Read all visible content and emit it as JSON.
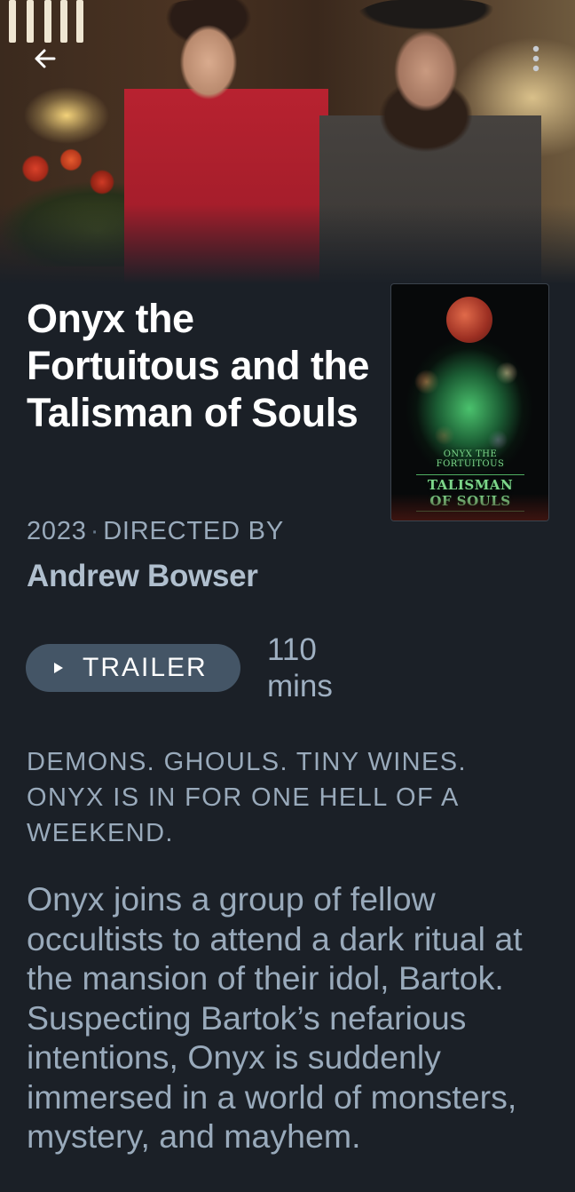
{
  "header": {
    "back_icon": "arrow-left-icon",
    "more_icon": "more-vertical-icon"
  },
  "film": {
    "title": "Onyx the Fortuitous and the Talisman of Souls",
    "year": "2023",
    "separator": "·",
    "directed_by_label": "DIRECTED BY",
    "director": "Andrew Bowser",
    "runtime": "110 mins",
    "tagline": "DEMONS. GHOULS. TINY WINES. ONYX IS IN FOR ONE HELL OF A WEEKEND.",
    "synopsis": "Onyx joins a group of fellow occultists to attend a dark ritual at the mansion of their idol, Bartok. Suspecting Bartok’s nefarious intentions, Onyx is suddenly immersed in a world of monsters, mystery, and mayhem.",
    "poster": {
      "logo_line1": "ONYX THE FORTUITOUS",
      "logo_line2": "TALISMAN OF SOULS"
    }
  },
  "actions": {
    "trailer_label": "TRAILER",
    "trailer_icon": "play-icon"
  },
  "colors": {
    "background": "#1b2027",
    "muted_text": "#99aabb",
    "button_bg": "#445566"
  }
}
